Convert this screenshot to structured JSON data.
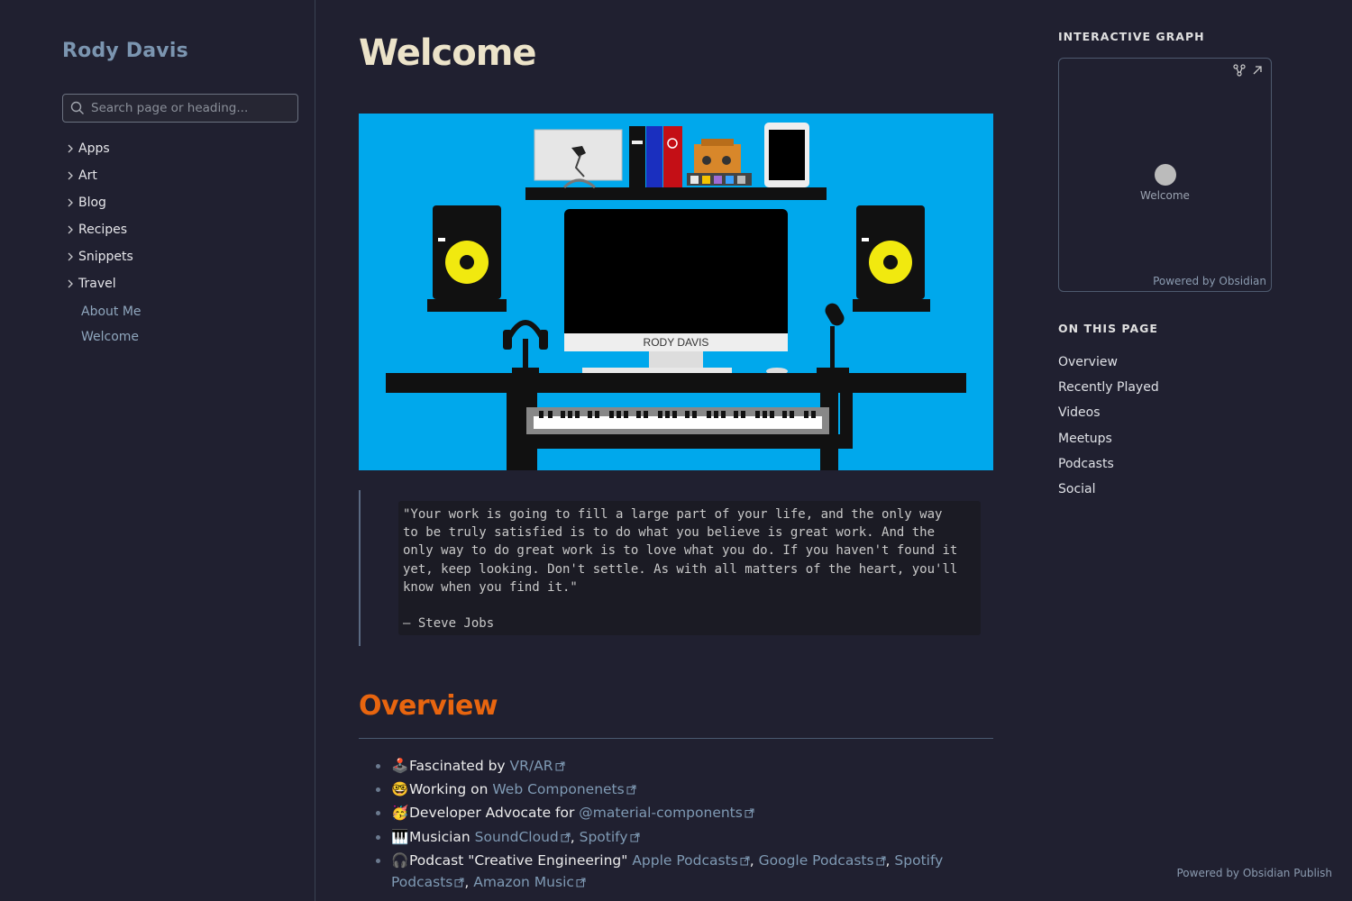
{
  "site": {
    "name": "Rody Davis"
  },
  "search": {
    "placeholder": "Search page or heading..."
  },
  "nav": {
    "folders": [
      "Apps",
      "Art",
      "Blog",
      "Recipes",
      "Snippets",
      "Travel"
    ],
    "files": [
      "About Me",
      "Welcome"
    ]
  },
  "page": {
    "title": "Welcome"
  },
  "hero": {
    "monitor_text": "RODY DAVIS"
  },
  "quote": {
    "text": "\"Your work is going to fill a large part of your life, and the only way\nto be truly satisfied is to do what you believe is great work. And the\nonly way to do great work is to love what you do. If you haven't found it\nyet, keep looking. Don't settle. As with all matters of the heart, you'll\nknow when you find it.\"\n\n— Steve Jobs"
  },
  "overview": {
    "heading": "Overview",
    "items": [
      {
        "emoji": "🕹️",
        "text": "Fascinated by ",
        "links": [
          "VR/AR"
        ]
      },
      {
        "emoji": "🤓",
        "text": "Working on ",
        "links": [
          "Web Componenets"
        ]
      },
      {
        "emoji": "🥳",
        "text": "Developer Advocate for ",
        "links": [
          "@material-components"
        ]
      },
      {
        "emoji": "🎹",
        "text": "Musician ",
        "links": [
          "SoundCloud",
          "Spotify"
        ]
      },
      {
        "emoji": "🎧",
        "text": "Podcast \"Creative Engineering\" ",
        "links": [
          "Apple Podcasts",
          "Google Podcasts",
          "Spotify Podcasts",
          "Amazon Music"
        ]
      }
    ]
  },
  "graph": {
    "heading": "INTERACTIVE GRAPH",
    "node_label": "Welcome",
    "powered": "Powered by Obsidian"
  },
  "toc": {
    "heading": "ON THIS PAGE",
    "items": [
      "Overview",
      "Recently Played",
      "Videos",
      "Meetups",
      "Podcasts",
      "Social"
    ]
  },
  "footer": {
    "text": "Powered by Obsidian Publish"
  },
  "colors": {
    "background": "#202030",
    "accent_heading": "#e8650f",
    "link": "#7f9ab4",
    "hero_bg": "#00a8ec"
  },
  "icons": {
    "search": "search-icon",
    "chevron": "chevron-right-icon",
    "external": "external-link-icon",
    "graph": "graph-icon",
    "expand": "expand-icon"
  }
}
